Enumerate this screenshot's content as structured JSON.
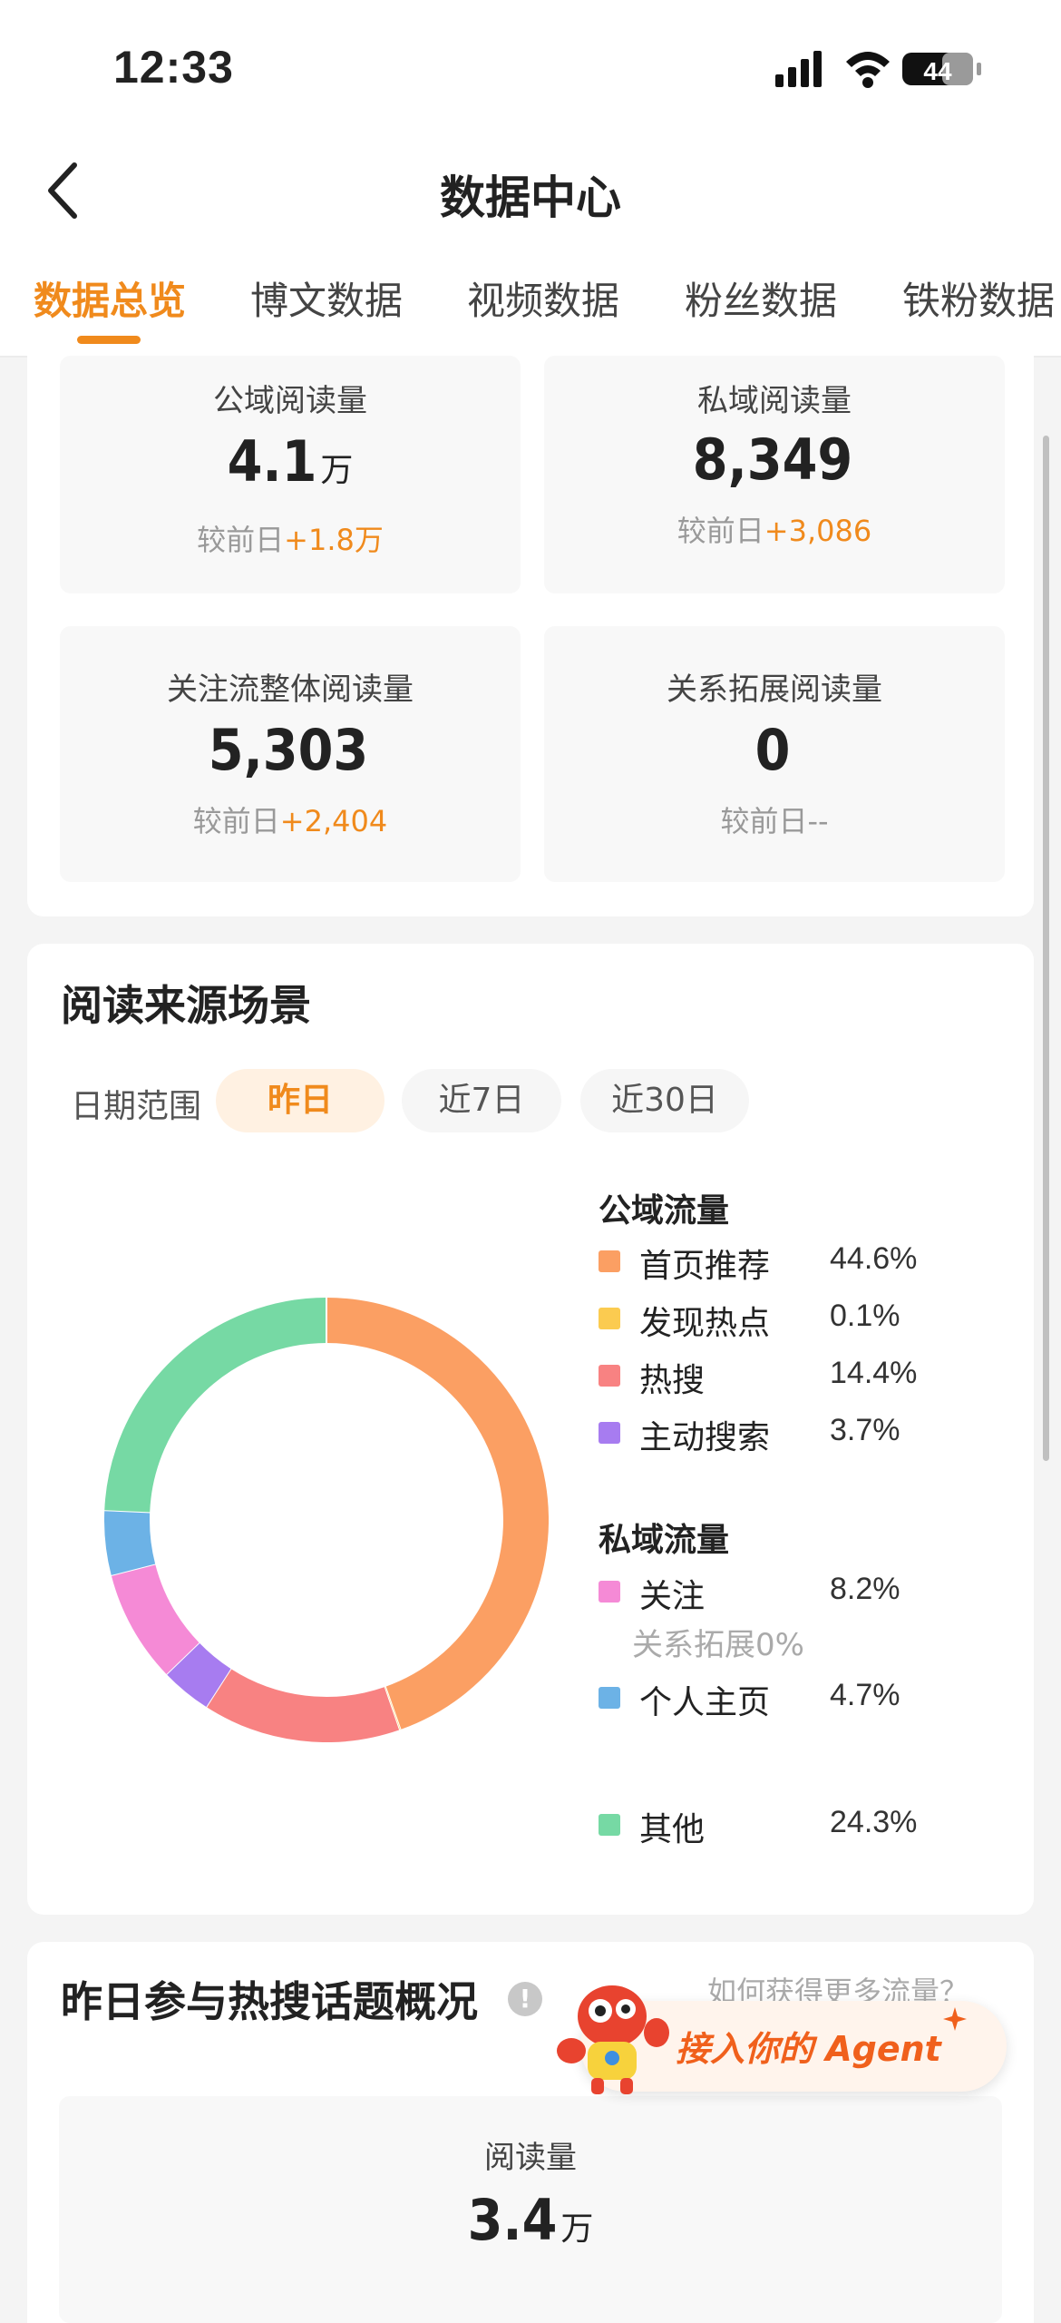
{
  "status_bar": {
    "time": "12:33",
    "battery": "44"
  },
  "nav": {
    "title": "数据中心"
  },
  "tabs": [
    "数据总览",
    "博文数据",
    "视频数据",
    "粉丝数据",
    "铁粉数据"
  ],
  "overview": {
    "metrics": [
      {
        "label": "公域阅读量",
        "value": "4.1",
        "unit": "万",
        "delta_prefix": "较前日",
        "delta": "+1.8万"
      },
      {
        "label": "私域阅读量",
        "value": "8,349",
        "unit": "",
        "delta_prefix": "较前日",
        "delta": "+3,086"
      },
      {
        "label": "关注流整体阅读量",
        "value": "5,303",
        "unit": "",
        "delta_prefix": "较前日",
        "delta": "+2,404"
      },
      {
        "label": "关系拓展阅读量",
        "value": "0",
        "unit": "",
        "delta_prefix": "较前日",
        "delta": "--"
      }
    ]
  },
  "read_source": {
    "title": "阅读来源场景",
    "range_label": "日期范围",
    "ranges": [
      "昨日",
      "近7日",
      "近30日"
    ],
    "active_range": "昨日",
    "public_title": "公域流量",
    "private_title": "私域流量",
    "relation_note": "关系拓展0%"
  },
  "chart_data": {
    "type": "pie",
    "style": "donut",
    "categories": [
      "首页推荐",
      "发现热点",
      "热搜",
      "主动搜索",
      "关注",
      "个人主页",
      "其他"
    ],
    "values": [
      44.6,
      0.1,
      14.4,
      3.7,
      8.2,
      4.7,
      24.3
    ],
    "labels": [
      "44.6%",
      "0.1%",
      "14.4%",
      "3.7%",
      "8.2%",
      "4.7%",
      "24.3%"
    ],
    "colors": [
      "#fb9f63",
      "#fbcb50",
      "#f88282",
      "#a77cf0",
      "#f58ad6",
      "#6cb2e6",
      "#76d9a4"
    ],
    "groups": [
      {
        "name": "公域流量",
        "members": [
          "首页推荐",
          "发现热点",
          "热搜",
          "主动搜索"
        ]
      },
      {
        "name": "私域流量",
        "members": [
          "关注",
          "个人主页"
        ]
      }
    ]
  },
  "hot_topics": {
    "title": "昨日参与热搜话题概况",
    "link": "如何获得更多流量？",
    "read_label": "阅读量",
    "read_value": "3.4",
    "read_unit": "万"
  },
  "agent_banner": {
    "text": "接入你的 Agent"
  }
}
